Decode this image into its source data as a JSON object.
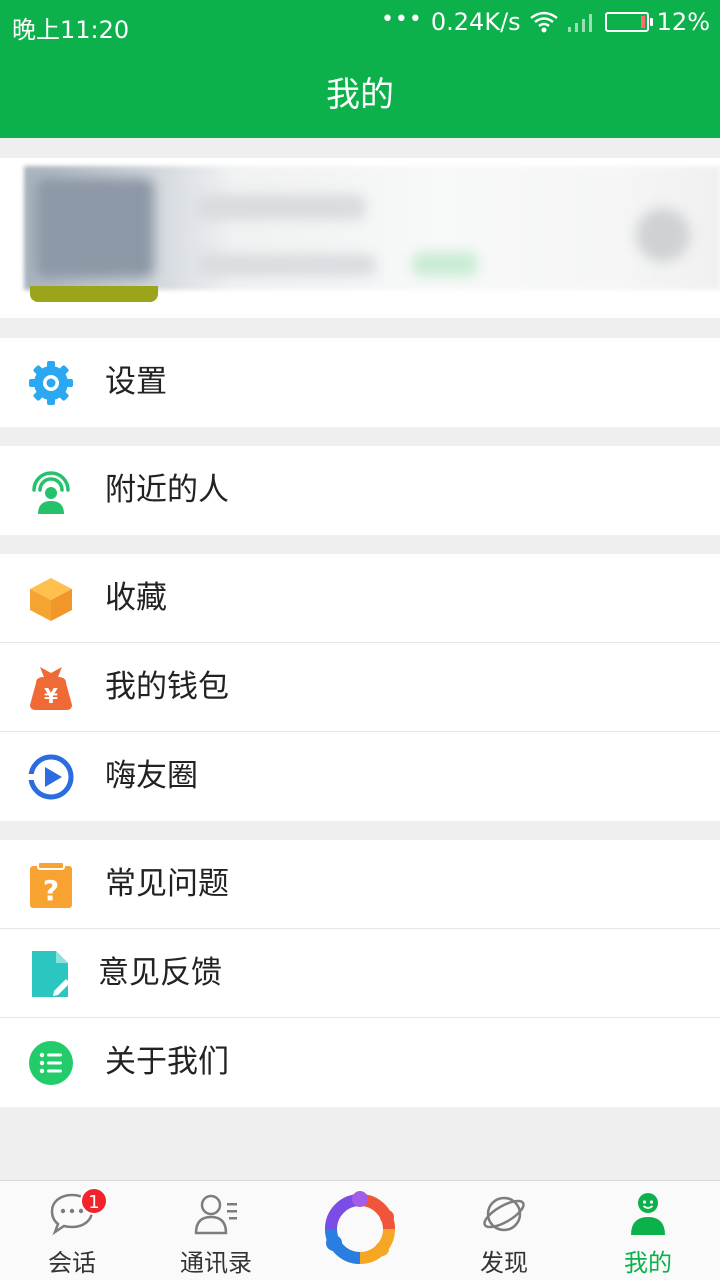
{
  "status_bar": {
    "time": "晚上11:20",
    "network_speed": "0.24K/s",
    "battery": "12%",
    "battery_level": 0.12
  },
  "header": {
    "title": "我的"
  },
  "groups": [
    {
      "items": [
        {
          "label": "设置",
          "icon": "gear-icon"
        }
      ]
    },
    {
      "items": [
        {
          "label": "附近的人",
          "icon": "nearby-people-icon"
        }
      ]
    },
    {
      "items": [
        {
          "label": "收藏",
          "icon": "box-icon"
        },
        {
          "label": "我的钱包",
          "icon": "wallet-icon"
        },
        {
          "label": "嗨友圈",
          "icon": "circle-play-icon"
        }
      ]
    },
    {
      "items": [
        {
          "label": "常见问题",
          "icon": "question-clipboard-icon"
        },
        {
          "label": "意见反馈",
          "icon": "feedback-doc-icon"
        },
        {
          "label": "关于我们",
          "icon": "list-icon"
        }
      ]
    }
  ],
  "tabbar": {
    "tabs": [
      {
        "label": "会话",
        "icon": "chat-icon",
        "badge": "1"
      },
      {
        "label": "通讯录",
        "icon": "contacts-icon"
      },
      {
        "label": "",
        "icon": "center-ring-icon"
      },
      {
        "label": "发现",
        "icon": "planet-icon"
      },
      {
        "label": "我的",
        "icon": "me-icon",
        "active": true
      }
    ]
  },
  "colors": {
    "brand_green": "#0db14b",
    "active_tab": "#0db14b",
    "badge_red": "#f2232b"
  }
}
